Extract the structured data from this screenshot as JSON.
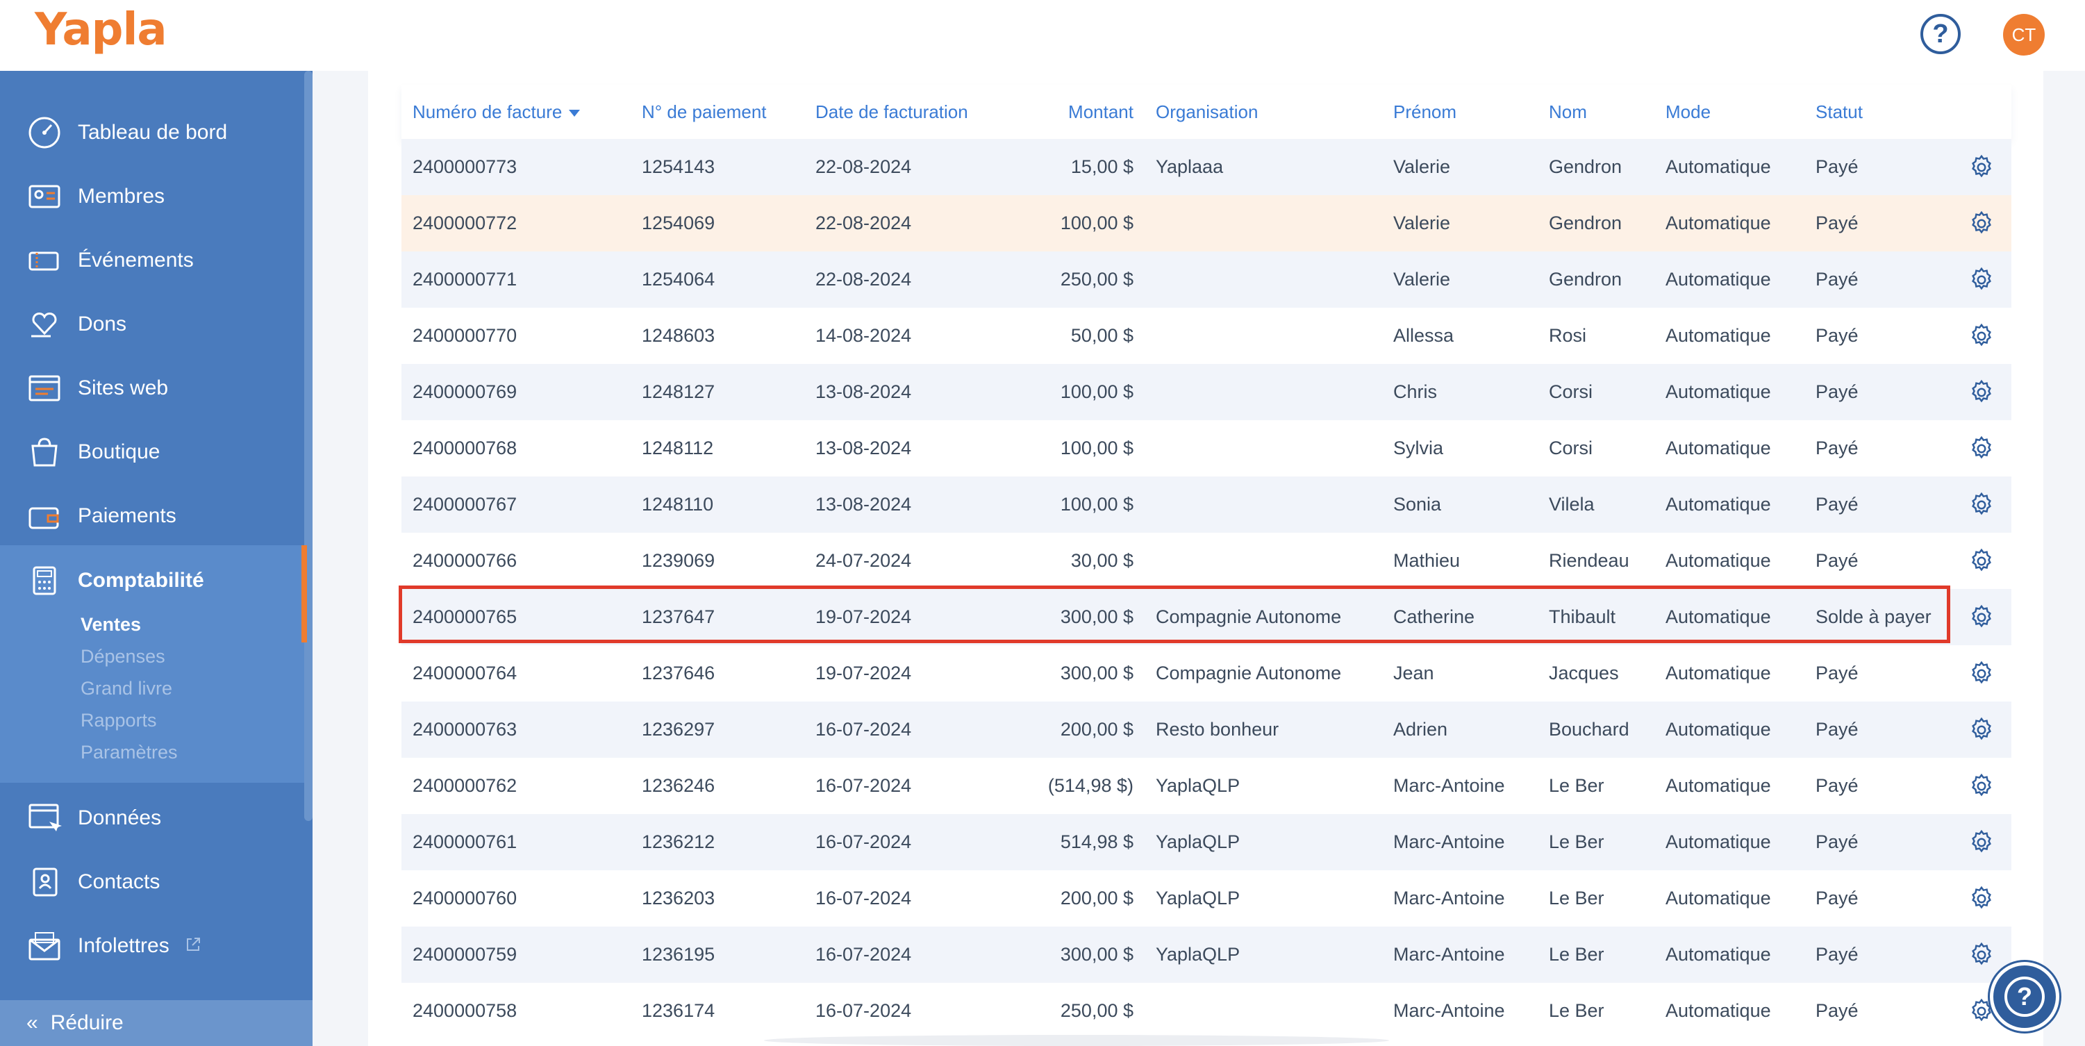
{
  "app": {
    "brand": "Yapla",
    "help_icon": "question-circle-icon",
    "avatar_initials": "CT"
  },
  "colors": {
    "brand_orange": "#ef7d31",
    "sidebar_blue": "#4a7bbd",
    "header_blue": "#3a7bd5",
    "highlight_red": "#e03a2a"
  },
  "sidebar": {
    "items": [
      {
        "label": "Tableau de bord",
        "icon": "dashboard-gauge-icon"
      },
      {
        "label": "Membres",
        "icon": "member-card-icon"
      },
      {
        "label": "Événements",
        "icon": "tickets-icon"
      },
      {
        "label": "Dons",
        "icon": "heart-hand-icon"
      },
      {
        "label": "Sites web",
        "icon": "website-icon"
      },
      {
        "label": "Boutique",
        "icon": "shopping-bag-icon"
      },
      {
        "label": "Paiements",
        "icon": "wallet-icon"
      },
      {
        "label": "Comptabilité",
        "icon": "calculator-icon"
      },
      {
        "label": "Données",
        "icon": "data-cursor-icon"
      },
      {
        "label": "Contacts",
        "icon": "contacts-book-icon"
      },
      {
        "label": "Infolettres",
        "icon": "newsletter-envelope-icon"
      }
    ],
    "sub_items": [
      "Ventes",
      "Dépenses",
      "Grand livre",
      "Rapports",
      "Paramètres"
    ],
    "reduce_label": "Réduire"
  },
  "table": {
    "headers": [
      "Numéro de facture",
      "N° de paiement",
      "Date de facturation",
      "Montant",
      "Organisation",
      "Prénom",
      "Nom",
      "Mode",
      "Statut"
    ],
    "rows": [
      [
        "2400000773",
        "1254143",
        "22-08-2024",
        "15,00 $",
        "Yaplaaa",
        "Valerie",
        "Gendron",
        "Automatique",
        "Payé"
      ],
      [
        "2400000772",
        "1254069",
        "22-08-2024",
        "100,00 $",
        "",
        "Valerie",
        "Gendron",
        "Automatique",
        "Payé"
      ],
      [
        "2400000771",
        "1254064",
        "22-08-2024",
        "250,00 $",
        "",
        "Valerie",
        "Gendron",
        "Automatique",
        "Payé"
      ],
      [
        "2400000770",
        "1248603",
        "14-08-2024",
        "50,00 $",
        "",
        "Allessa",
        "Rosi",
        "Automatique",
        "Payé"
      ],
      [
        "2400000769",
        "1248127",
        "13-08-2024",
        "100,00 $",
        "",
        "Chris",
        "Corsi",
        "Automatique",
        "Payé"
      ],
      [
        "2400000768",
        "1248112",
        "13-08-2024",
        "100,00 $",
        "",
        "Sylvia",
        "Corsi",
        "Automatique",
        "Payé"
      ],
      [
        "2400000767",
        "1248110",
        "13-08-2024",
        "100,00 $",
        "",
        "Sonia",
        "Vilela",
        "Automatique",
        "Payé"
      ],
      [
        "2400000766",
        "1239069",
        "24-07-2024",
        "30,00 $",
        "",
        "Mathieu",
        "Riendeau",
        "Automatique",
        "Payé"
      ],
      [
        "2400000765",
        "1237647",
        "19-07-2024",
        "300,00 $",
        "Compagnie Autonome",
        "Catherine",
        "Thibault",
        "Automatique",
        "Solde à payer"
      ],
      [
        "2400000764",
        "1237646",
        "19-07-2024",
        "300,00 $",
        "Compagnie Autonome",
        "Jean",
        "Jacques",
        "Automatique",
        "Payé"
      ],
      [
        "2400000763",
        "1236297",
        "16-07-2024",
        "200,00 $",
        "Resto bonheur",
        "Adrien",
        "Bouchard",
        "Automatique",
        "Payé"
      ],
      [
        "2400000762",
        "1236246",
        "16-07-2024",
        "(514,98 $)",
        "YaplaQLP",
        "Marc-Antoine",
        "Le Ber",
        "Automatique",
        "Payé"
      ],
      [
        "2400000761",
        "1236212",
        "16-07-2024",
        "514,98 $",
        "YaplaQLP",
        "Marc-Antoine",
        "Le Ber",
        "Automatique",
        "Payé"
      ],
      [
        "2400000760",
        "1236203",
        "16-07-2024",
        "200,00 $",
        "YaplaQLP",
        "Marc-Antoine",
        "Le Ber",
        "Automatique",
        "Payé"
      ],
      [
        "2400000759",
        "1236195",
        "16-07-2024",
        "300,00 $",
        "YaplaQLP",
        "Marc-Antoine",
        "Le Ber",
        "Automatique",
        "Payé"
      ],
      [
        "2400000758",
        "1236174",
        "16-07-2024",
        "250,00 $",
        "",
        "Marc-Antoine",
        "Le Ber",
        "Automatique",
        "Payé"
      ]
    ],
    "row_action_icon": "gear-icon",
    "highlighted_row": "2400000765"
  },
  "support_button": {
    "icon": "question-circle-icon"
  }
}
